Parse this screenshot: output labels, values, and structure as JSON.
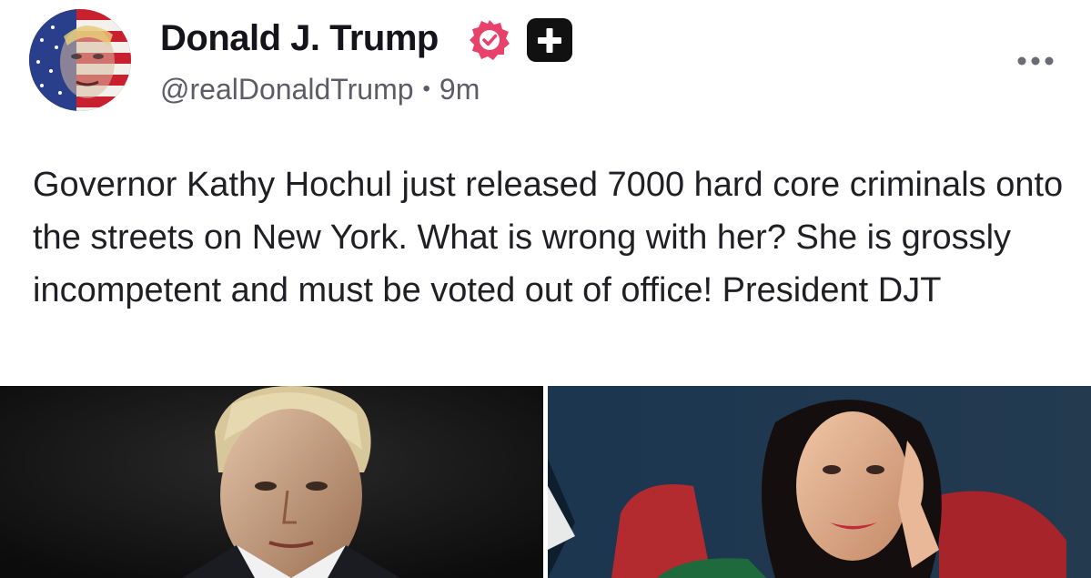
{
  "author": {
    "display_name": "Donald J. Trump",
    "handle": "@realDonaldTrump",
    "separator": "•",
    "timestamp": "9m",
    "verified_color": "#e8426b",
    "avatar": "flag-portrait-avatar"
  },
  "icons": {
    "verified": "verified-badge-icon",
    "plus_badge": "plus-badge-icon",
    "more": "more-options-icon"
  },
  "post": {
    "text": "Governor Kathy Hochul just released 7000 hard core criminals onto the streets on New York. What is wrong with her? She is grossly incompetent and must be voted out of office! President DJT"
  },
  "media": [
    {
      "name": "photo-man-portrait"
    },
    {
      "name": "photo-woman-portrait"
    }
  ]
}
